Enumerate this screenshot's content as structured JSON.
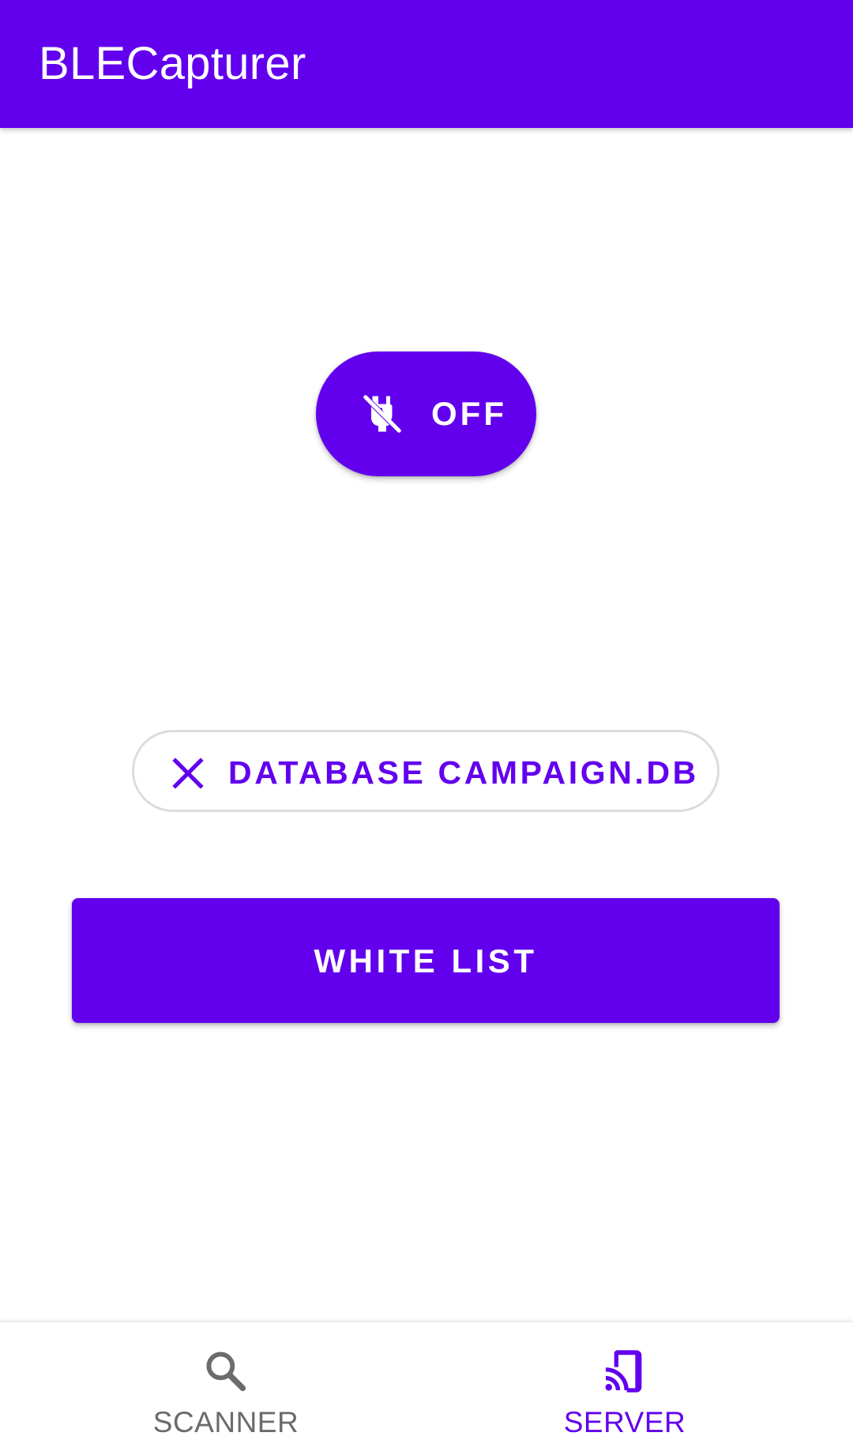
{
  "app_bar": {
    "title": "BLECapturer",
    "color": "#6200EE"
  },
  "server_screen": {
    "power_toggle": {
      "label": "OFF",
      "icon": "power-off-plug-icon",
      "state": "off"
    },
    "database_chip": {
      "label": "DATABASE CAMPAIGN.DB",
      "icon": "close-icon"
    },
    "white_list_button": {
      "label": "WHITE LIST"
    }
  },
  "bottom_nav": {
    "items": [
      {
        "label": "SCANNER",
        "icon": "search-icon",
        "selected": false
      },
      {
        "label": "SERVER",
        "icon": "cast-phone-icon",
        "selected": true
      }
    ],
    "active_color": "#6200EE",
    "inactive_color": "#6b6b6b"
  }
}
